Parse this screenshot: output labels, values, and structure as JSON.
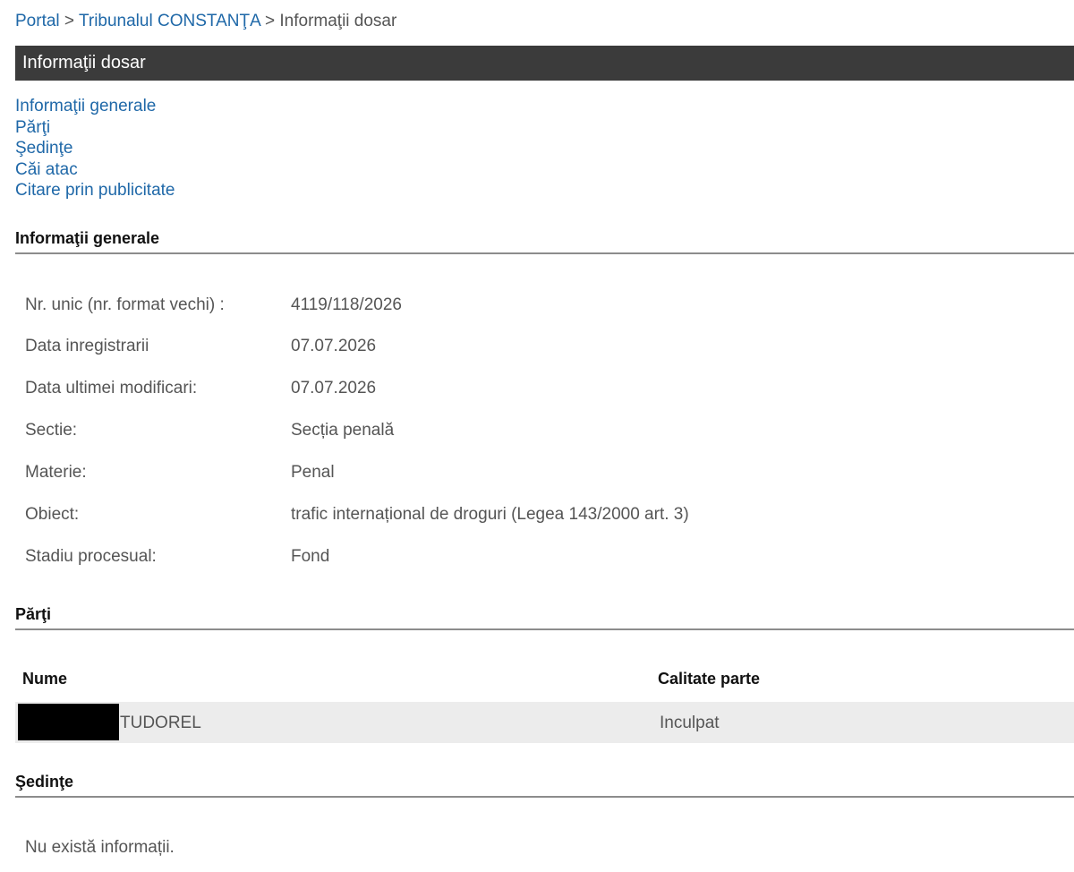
{
  "breadcrumb": {
    "portal": "Portal",
    "sep1": ">",
    "court": "Tribunalul CONSTANŢA",
    "sep2": ">",
    "current": "Informaţii dosar"
  },
  "title": "Informaţii dosar",
  "nav": {
    "items": [
      "Informaţii generale",
      "Părţi",
      "Şedinţe",
      "Căi atac",
      "Citare prin publicitate"
    ]
  },
  "general": {
    "heading": "Informaţii generale",
    "rows": [
      {
        "label": "Nr. unic (nr. format vechi) :",
        "value": "4119/118/2026"
      },
      {
        "label": "Data inregistrarii",
        "value": "07.07.2026"
      },
      {
        "label": "Data ultimei modificari:",
        "value": "07.07.2026"
      },
      {
        "label": "Sectie:",
        "value": "Secția penală"
      },
      {
        "label": "Materie:",
        "value": "Penal"
      },
      {
        "label": "Obiect:",
        "value": "trafic internațional de droguri (Legea 143/2000 art. 3)"
      },
      {
        "label": "Stadiu procesual:",
        "value": "Fond"
      }
    ]
  },
  "parti": {
    "heading": "Părţi",
    "columns": [
      "Nume",
      "Calitate parte"
    ],
    "rows": [
      {
        "name": "TUDOREL",
        "role": "Inculpat"
      }
    ]
  },
  "sedinte": {
    "heading": "Şedinţe",
    "empty_text": "Nu există informații."
  }
}
